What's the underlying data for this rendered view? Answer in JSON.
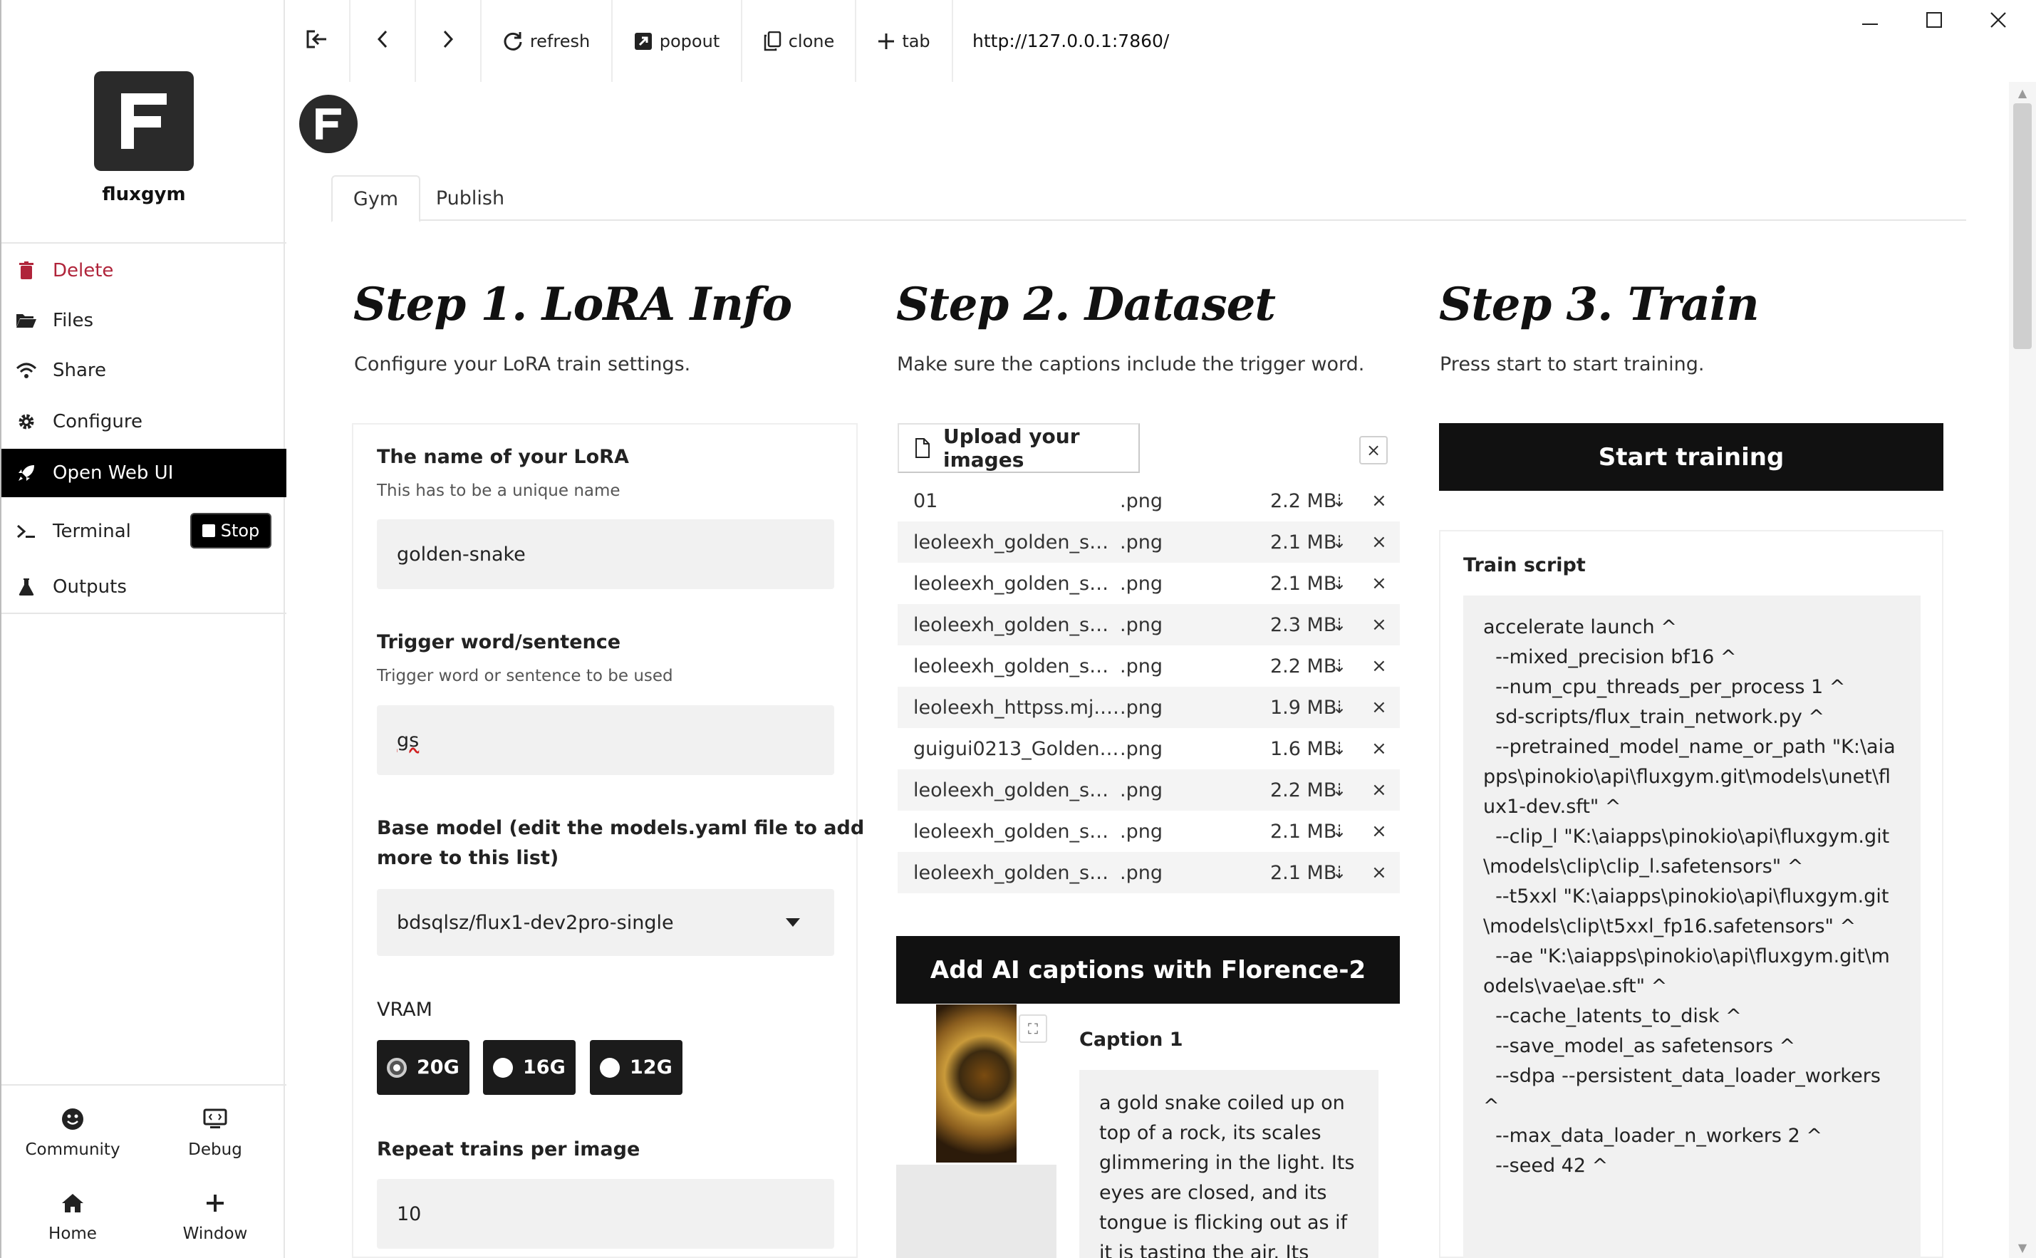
{
  "sidebar": {
    "app_name": "fluxgym",
    "items": {
      "delete": "Delete",
      "files": "Files",
      "share": "Share",
      "configure": "Configure",
      "open_web_ui": "Open Web UI",
      "terminal": "Terminal",
      "outputs": "Outputs"
    },
    "stop_label": "Stop",
    "bottom": {
      "community": "Community",
      "debug": "Debug",
      "home": "Home",
      "window": "Window"
    }
  },
  "topbar": {
    "refresh": "refresh",
    "popout": "popout",
    "clone": "clone",
    "tab": "tab",
    "url": "http://127.0.0.1:7860/"
  },
  "tabs": {
    "gym": "Gym",
    "publish": "Publish"
  },
  "step1": {
    "title": "Step 1. LoRA Info",
    "subtitle": "Configure your LoRA train settings.",
    "lora_name_label": "The name of your LoRA",
    "lora_name_hint": "This has to be a unique name",
    "lora_name_value": "golden-snake",
    "trigger_label": "Trigger word/sentence",
    "trigger_hint": "Trigger word or sentence to be used",
    "trigger_value": "gs",
    "base_model_label_line1": "Base model (edit the models.yaml file to add",
    "base_model_label_line2": "more to this list)",
    "base_model_value": "bdsqlsz/flux1-dev2pro-single",
    "vram_label": "VRAM",
    "vram_options": [
      "20G",
      "16G",
      "12G"
    ],
    "vram_selected": "20G",
    "repeat_label": "Repeat trains per image",
    "repeat_value": "10"
  },
  "step2": {
    "title": "Step 2. Dataset",
    "subtitle": "Make sure the captions include the trigger word.",
    "upload_label": "Upload your images",
    "clear_symbol": "×",
    "files": [
      {
        "name": "01",
        "ext": ".png",
        "size": "2.2 MB"
      },
      {
        "name": "leoleexh_golden_sn…",
        "ext": ".png",
        "size": "2.1 MB"
      },
      {
        "name": "leoleexh_golden_sn…",
        "ext": ".png",
        "size": "2.1 MB"
      },
      {
        "name": "leoleexh_golden_sn…",
        "ext": ".png",
        "size": "2.3 MB"
      },
      {
        "name": "leoleexh_golden_sn…",
        "ext": ".png",
        "size": "2.2 MB"
      },
      {
        "name": "leoleexh_httpss.mj.r…",
        "ext": ".png",
        "size": "1.9 MB"
      },
      {
        "name": "guigui0213_Golden_…",
        "ext": ".png",
        "size": "1.6 MB"
      },
      {
        "name": "leoleexh_golden_sn…",
        "ext": ".png",
        "size": "2.2 MB"
      },
      {
        "name": "leoleexh_golden_sn…",
        "ext": ".png",
        "size": "2.1 MB"
      },
      {
        "name": "leoleexh_golden_sn…",
        "ext": ".png",
        "size": "2.1 MB"
      }
    ],
    "add_captions_label": "Add AI captions with Florence-2",
    "caption_label": "Caption 1",
    "caption_text": "a gold snake coiled up on top of a rock, its scales glimmering in the light. Its eyes are closed, and its tongue is flicking out as if it is tasting the air. Its body is"
  },
  "step3": {
    "title": "Step 3. Train",
    "subtitle": "Press start to start training.",
    "start_label": "Start training",
    "script_label": "Train script",
    "script_text": "accelerate launch ^\n  --mixed_precision bf16 ^\n  --num_cpu_threads_per_process 1 ^\n  sd-scripts/flux_train_network.py ^\n  --pretrained_model_name_or_path \"K:\\aiapps\\pinokio\\api\\fluxgym.git\\models\\unet\\flux1-dev.sft\" ^\n  --clip_l \"K:\\aiapps\\pinokio\\api\\fluxgym.git\\models\\clip\\clip_l.safetensors\" ^\n  --t5xxl \"K:\\aiapps\\pinokio\\api\\fluxgym.git\\models\\clip\\t5xxl_fp16.safetensors\" ^\n  --ae \"K:\\aiapps\\pinokio\\api\\fluxgym.git\\models\\vae\\ae.sft\" ^\n  --cache_latents_to_disk ^\n  --save_model_as safetensors ^\n  --sdpa --persistent_data_loader_workers ^\n  --max_data_loader_n_workers 2 ^\n  --seed 42 ^"
  }
}
